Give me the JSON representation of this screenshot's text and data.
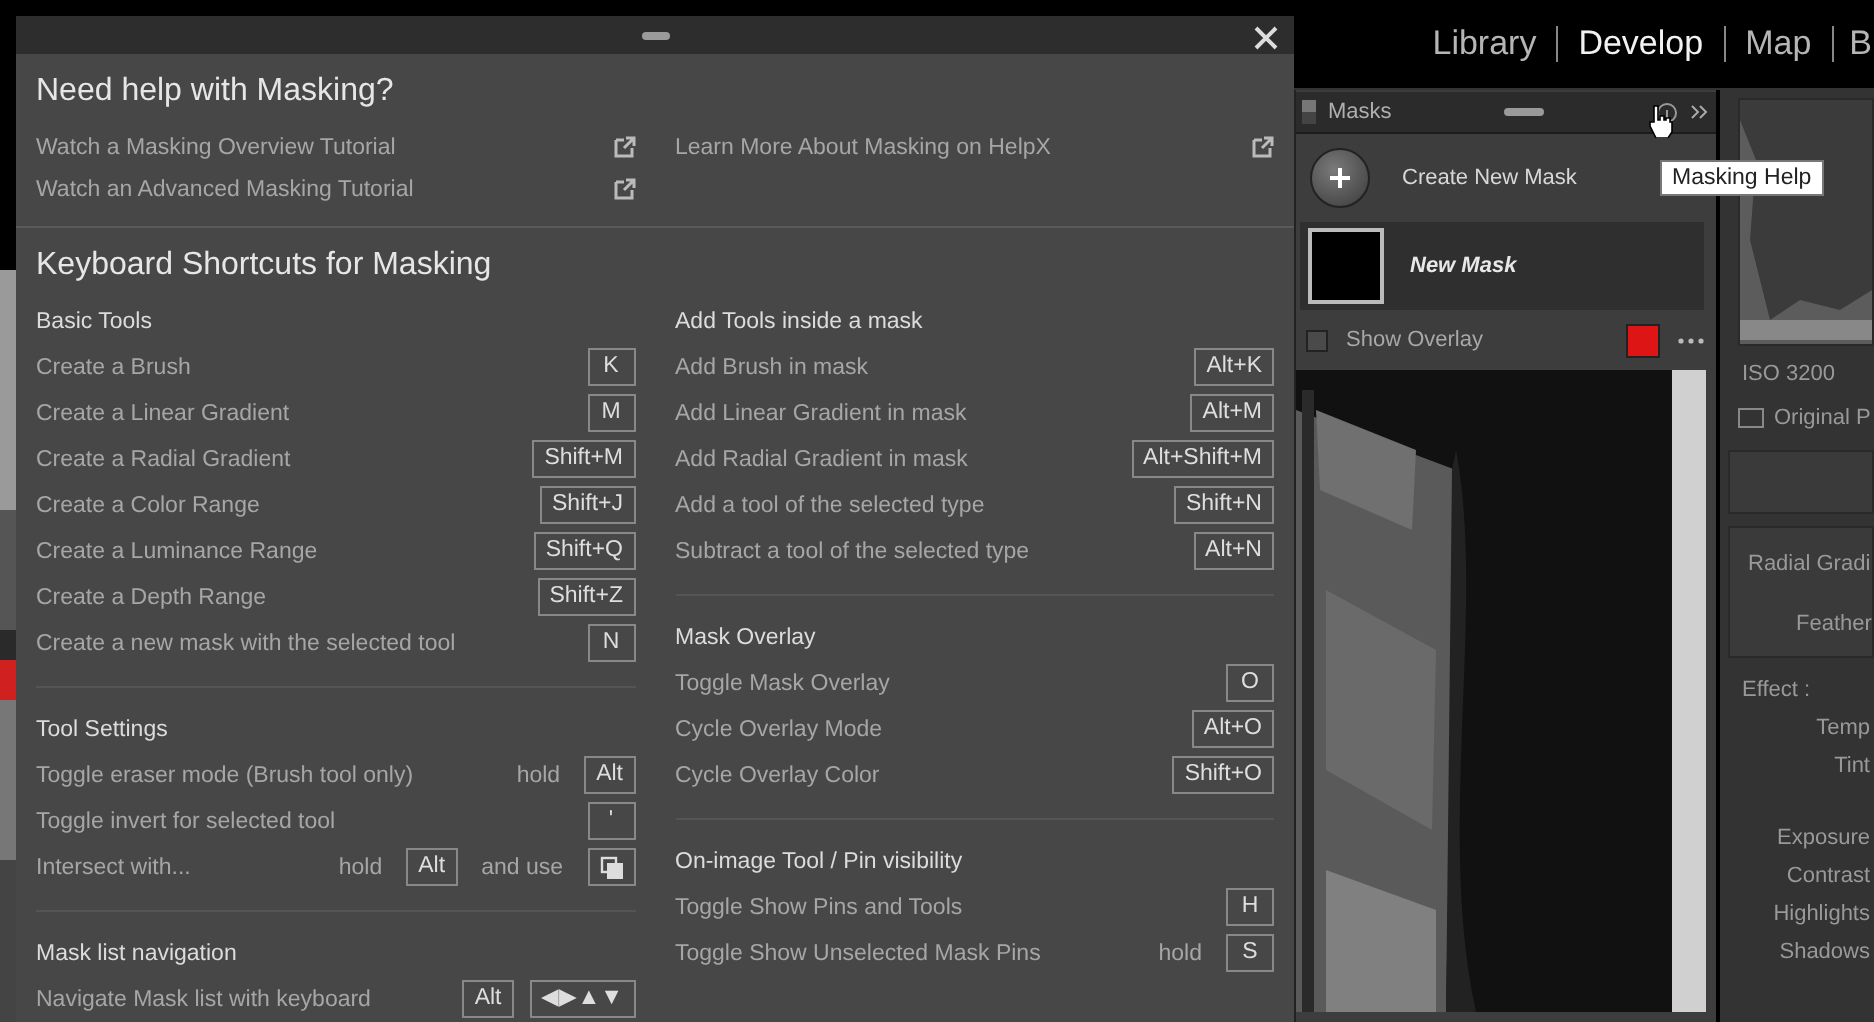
{
  "help_dialog": {
    "help_title": "Need help with Masking?",
    "links": [
      [
        {
          "label": "Watch a Masking Overview Tutorial"
        },
        {
          "label": "Watch an Advanced Masking Tutorial"
        }
      ],
      [
        {
          "label": "Learn More About Masking on HelpX"
        }
      ]
    ],
    "shortcuts_title": "Keyboard Shortcuts for Masking",
    "columns": [
      [
        {
          "title": "Basic Tools",
          "rows": [
            {
              "label": "Create a Brush",
              "parts": [
                {
                  "kind": "key",
                  "text": "K"
                }
              ]
            },
            {
              "label": "Create a Linear Gradient",
              "parts": [
                {
                  "kind": "key",
                  "text": "M"
                }
              ]
            },
            {
              "label": "Create a Radial Gradient",
              "parts": [
                {
                  "kind": "key",
                  "text": "Shift+M"
                }
              ]
            },
            {
              "label": "Create a Color Range",
              "parts": [
                {
                  "kind": "key",
                  "text": "Shift+J"
                }
              ]
            },
            {
              "label": "Create a Luminance Range",
              "parts": [
                {
                  "kind": "key",
                  "text": "Shift+Q"
                }
              ]
            },
            {
              "label": "Create a Depth Range",
              "parts": [
                {
                  "kind": "key",
                  "text": "Shift+Z"
                }
              ]
            },
            {
              "label": "Create a new mask with the selected tool",
              "parts": [
                {
                  "kind": "key",
                  "text": "N"
                }
              ]
            }
          ]
        },
        {
          "title": "Tool Settings",
          "rows": [
            {
              "label": "Toggle eraser mode (Brush tool only)",
              "parts": [
                {
                  "kind": "word",
                  "text": "hold"
                },
                {
                  "kind": "key",
                  "text": "Alt"
                }
              ]
            },
            {
              "label": "Toggle invert for selected tool",
              "parts": [
                {
                  "kind": "key",
                  "text": "'"
                }
              ]
            },
            {
              "label": "Intersect with...",
              "parts": [
                {
                  "kind": "word",
                  "text": "hold"
                },
                {
                  "kind": "key",
                  "text": "Alt"
                },
                {
                  "kind": "word",
                  "text": "and use"
                },
                {
                  "kind": "icon_key"
                }
              ]
            }
          ]
        },
        {
          "title": "Mask list navigation",
          "rows": [
            {
              "label": "Navigate Mask list with keyboard",
              "parts": [
                {
                  "kind": "key",
                  "text": "Alt"
                },
                {
                  "kind": "key",
                  "text": "◀▶▲▼"
                }
              ]
            }
          ]
        }
      ],
      [
        {
          "title": "Add Tools inside a mask",
          "rows": [
            {
              "label": "Add Brush in mask",
              "parts": [
                {
                  "kind": "key",
                  "text": "Alt+K"
                }
              ]
            },
            {
              "label": "Add Linear Gradient in mask",
              "parts": [
                {
                  "kind": "key",
                  "text": "Alt+M"
                }
              ]
            },
            {
              "label": "Add Radial Gradient in mask",
              "parts": [
                {
                  "kind": "key",
                  "text": "Alt+Shift+M"
                }
              ]
            },
            {
              "label": "Add a tool of the selected type",
              "parts": [
                {
                  "kind": "key",
                  "text": "Shift+N"
                }
              ]
            },
            {
              "label": "Subtract a tool of the selected type",
              "parts": [
                {
                  "kind": "key",
                  "text": "Alt+N"
                }
              ]
            }
          ]
        },
        {
          "title": "Mask Overlay",
          "rows": [
            {
              "label": "Toggle Mask Overlay",
              "parts": [
                {
                  "kind": "key",
                  "text": "O"
                }
              ]
            },
            {
              "label": "Cycle Overlay Mode",
              "parts": [
                {
                  "kind": "key",
                  "text": "Alt+O"
                }
              ]
            },
            {
              "label": "Cycle Overlay Color",
              "parts": [
                {
                  "kind": "key",
                  "text": "Shift+O"
                }
              ]
            }
          ]
        },
        {
          "title": "On-image Tool / Pin visibility",
          "rows": [
            {
              "label": "Toggle Show Pins and Tools",
              "parts": [
                {
                  "kind": "key",
                  "text": "H"
                }
              ]
            },
            {
              "label": "Toggle Show Unselected Mask Pins",
              "parts": [
                {
                  "kind": "word",
                  "text": "hold"
                },
                {
                  "kind": "key",
                  "text": "S"
                }
              ]
            }
          ]
        }
      ]
    ]
  },
  "top_nav": {
    "modules": [
      {
        "label": "Library",
        "selected": false
      },
      {
        "label": "Develop",
        "selected": true
      },
      {
        "label": "Map",
        "selected": false
      },
      {
        "label": "B",
        "selected": false
      }
    ]
  },
  "masks_panel": {
    "title": "Masks",
    "tooltip": "Masking Help",
    "create_label": "Create New Mask",
    "masks": [
      {
        "name": "New Mask",
        "selected": true
      }
    ],
    "show_overlay": {
      "label": "Show Overlay",
      "checked": false,
      "color": "#dd1515"
    }
  },
  "right_panel": {
    "iso": "ISO 3200",
    "original": {
      "label": "Original P",
      "checked": false
    },
    "mask_type": "Radial Gradi",
    "feather": "Feather",
    "effect": "Effect :",
    "color_sliders": [
      "Temp",
      "Tint"
    ],
    "tone_sliders": [
      "Exposure",
      "Contrast",
      "Highlights",
      "Shadows"
    ]
  }
}
